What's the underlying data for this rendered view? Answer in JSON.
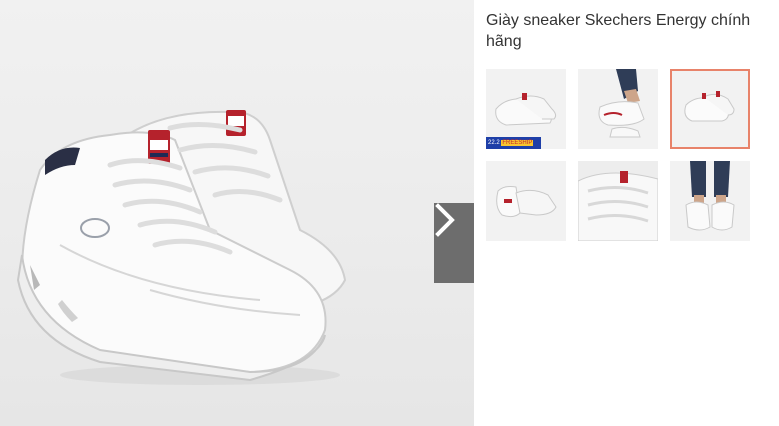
{
  "product": {
    "title": "Giày sneaker Skechers Energy chính hãng"
  },
  "gallery": {
    "next_icon": "chevron-right-icon",
    "selected_index": 2,
    "thumbnails": [
      {
        "name": "thumb-pair-side",
        "badge": "22.2",
        "badge_text": "FREESHIP"
      },
      {
        "name": "thumb-worn-legs"
      },
      {
        "name": "thumb-pair-front"
      },
      {
        "name": "thumb-pair-back"
      },
      {
        "name": "thumb-laces-closeup"
      },
      {
        "name": "thumb-worn-front"
      }
    ]
  },
  "colors": {
    "selected_border": "#e8836a",
    "arrow_bg": "#6d6d6d",
    "badge_blue": "#1e3fa8",
    "badge_yellow": "#f7c52f",
    "title_text": "#333333"
  }
}
